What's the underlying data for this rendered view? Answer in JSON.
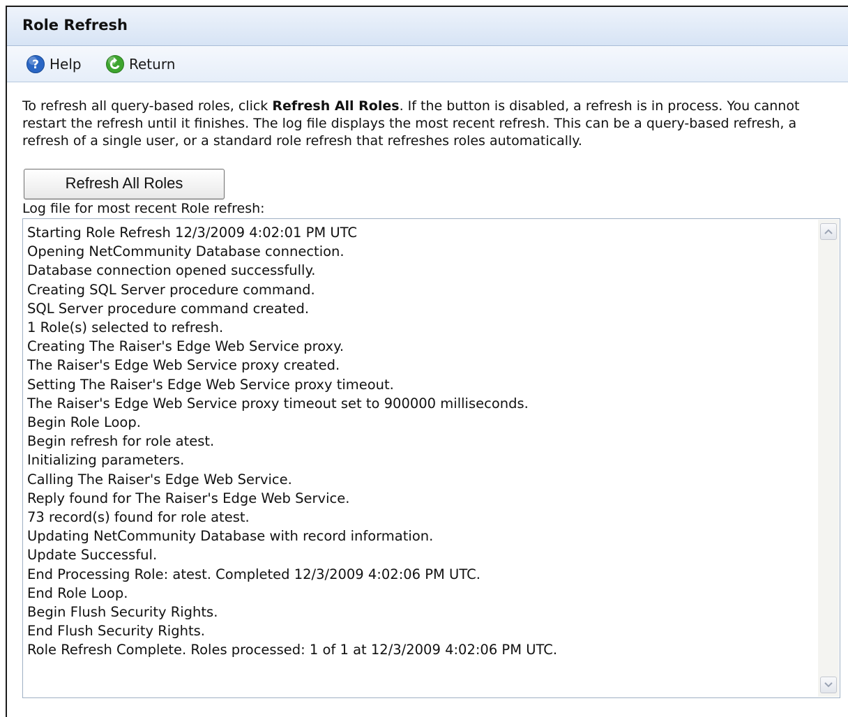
{
  "page": {
    "title": "Role Refresh"
  },
  "toolbar": {
    "help_label": "Help",
    "return_label": "Return"
  },
  "instructions": {
    "part1": "To refresh all query-based roles, click ",
    "bold": "Refresh All Roles",
    "part2": ". If the button is disabled, a refresh is in process. You cannot restart the refresh until it finishes. The log file displays the most recent refresh. This can be a query-based refresh, a refresh of a single user, or a standard role refresh that refreshes roles automatically."
  },
  "refresh_button_label": "Refresh All Roles",
  "log": {
    "label": "Log file for most recent Role refresh:",
    "lines": [
      "Starting Role Refresh 12/3/2009 4:02:01 PM UTC",
      "Opening NetCommunity Database connection.",
      "Database connection opened successfully.",
      "Creating SQL Server procedure command.",
      "SQL Server procedure command created.",
      "1 Role(s) selected to refresh.",
      "Creating The Raiser's Edge Web Service proxy.",
      "The Raiser's Edge Web Service proxy created.",
      "Setting The Raiser's Edge Web Service proxy timeout.",
      "The Raiser's Edge Web Service proxy timeout set to 900000 milliseconds.",
      "Begin Role Loop.",
      "Begin refresh for role atest.",
      "Initializing parameters.",
      "Calling The Raiser's Edge Web Service.",
      "Reply found for The Raiser's Edge Web Service.",
      "73 record(s) found for role atest.",
      "Updating NetCommunity Database with record information.",
      "Update Successful.",
      "End Processing Role: atest. Completed 12/3/2009 4:02:06 PM UTC.",
      "End Role Loop.",
      "Begin Flush Security Rights.",
      "End Flush Security Rights.",
      "Role Refresh Complete. Roles processed: 1 of 1 at 12/3/2009 4:02:06 PM UTC."
    ]
  },
  "icons": {
    "help": "help-icon",
    "return": "return-icon",
    "scroll_up": "chevron-up-icon",
    "scroll_down": "chevron-down-icon"
  },
  "colors": {
    "header_bg": "#d7e4f5",
    "help_icon": "#2a66c4",
    "return_icon": "#3ea52f"
  }
}
